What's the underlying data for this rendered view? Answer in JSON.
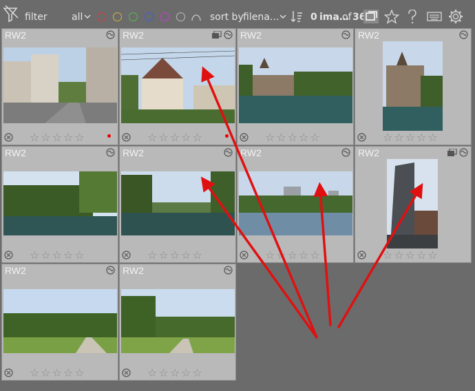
{
  "toolbar": {
    "filter_label": "filter",
    "rating_filter": "all",
    "color_labels": [
      {
        "name": "red",
        "color": "#e03a3a"
      },
      {
        "name": "yellow",
        "color": "#d9b23a"
      },
      {
        "name": "green",
        "color": "#4fbf4f"
      },
      {
        "name": "blue",
        "color": "#3a5fe0"
      },
      {
        "name": "purple",
        "color": "#c93ad9"
      },
      {
        "name": "grey",
        "color": "#bdbdbd"
      }
    ],
    "sort_label": "sort by",
    "sort_value": "filena…",
    "count_selected": "0",
    "count_label": "ima…",
    "count_of": "of",
    "count_total": "36"
  },
  "thumbnails": [
    {
      "ext": "RW2",
      "group": false,
      "dot": true,
      "photo": "street",
      "stars": [
        "☆",
        "☆",
        "☆",
        "☆",
        "☆"
      ]
    },
    {
      "ext": "RW2",
      "group": true,
      "dot": true,
      "photo": "house",
      "stars": [
        "☆",
        "☆",
        "☆",
        "☆",
        "☆"
      ]
    },
    {
      "ext": "RW2",
      "group": false,
      "dot": false,
      "photo": "castle-river",
      "stars": [
        "☆",
        "☆",
        "☆",
        "☆",
        "☆"
      ]
    },
    {
      "ext": "RW2",
      "group": false,
      "dot": false,
      "photo": "castle-portrait",
      "stars": [
        "☆",
        "☆",
        "☆",
        "☆",
        "☆"
      ]
    },
    {
      "ext": "RW2",
      "group": false,
      "dot": false,
      "photo": "river-trees",
      "stars": [
        "☆",
        "☆",
        "☆",
        "☆",
        "☆"
      ]
    },
    {
      "ext": "RW2",
      "group": false,
      "dot": false,
      "photo": "river-trees-2",
      "stars": [
        "☆",
        "☆",
        "☆",
        "☆",
        "☆"
      ]
    },
    {
      "ext": "RW2",
      "group": false,
      "dot": false,
      "photo": "lake-city",
      "stars": [
        "☆",
        "☆",
        "☆",
        "☆",
        "☆"
      ]
    },
    {
      "ext": "RW2",
      "group": true,
      "dot": false,
      "photo": "tower",
      "stars": [
        "☆",
        "☆",
        "☆",
        "☆",
        "☆"
      ]
    },
    {
      "ext": "RW2",
      "group": false,
      "dot": false,
      "photo": "park",
      "stars": [
        "☆",
        "☆",
        "☆",
        "☆",
        "☆"
      ]
    },
    {
      "ext": "RW2",
      "group": false,
      "dot": false,
      "photo": "park-2",
      "stars": [
        "☆",
        "☆",
        "☆",
        "☆",
        "☆"
      ]
    }
  ],
  "annotation_color": "#e01010"
}
